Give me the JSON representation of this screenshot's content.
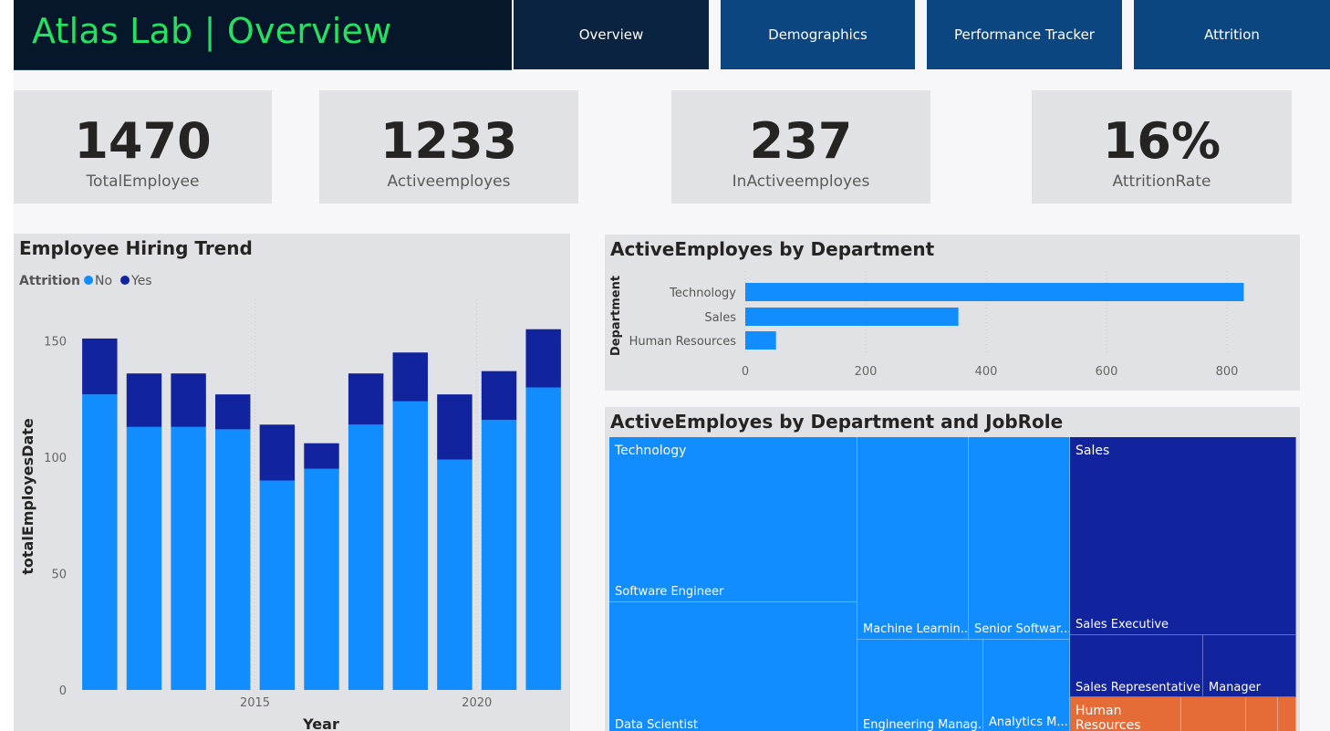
{
  "header": {
    "title": "Atlas Lab | Overview",
    "tabs": [
      {
        "label": "Overview",
        "active": true
      },
      {
        "label": "Demographics",
        "active": false
      },
      {
        "label": "Performance Tracker",
        "active": false
      },
      {
        "label": "Attrition",
        "active": false
      }
    ]
  },
  "kpis": [
    {
      "value": "1470",
      "label": "TotalEmployee"
    },
    {
      "value": "1233",
      "label": "Activeemployes"
    },
    {
      "value": "237",
      "label": "InActiveemployes"
    },
    {
      "value": "16%",
      "label": "AttritionRate"
    }
  ],
  "colors": {
    "no": "#118dff",
    "yes": "#12239e",
    "hr": "#e66c37",
    "title_green": "#26e062"
  },
  "hiring_chart": {
    "title": "Employee Hiring Trend",
    "legend_title": "Attrition",
    "chart_data": {
      "type": "bar",
      "stacked": true,
      "title": "Employee Hiring Trend",
      "xlabel": "Year",
      "ylabel": "totalEmployesDate",
      "categories": [
        2012,
        2013,
        2014,
        2015,
        2016,
        2017,
        2018,
        2019,
        2020,
        2021,
        2022
      ],
      "x_tick_labels": [
        "2015",
        "2020"
      ],
      "y_ticks": [
        0,
        50,
        100,
        150
      ],
      "ylim": [
        0,
        160
      ],
      "grid": true,
      "legend": "top-left",
      "series": [
        {
          "name": "No",
          "values": [
            127,
            113,
            113,
            112,
            90,
            95,
            114,
            124,
            99,
            116,
            130
          ]
        },
        {
          "name": "Yes",
          "values": [
            24,
            23,
            23,
            15,
            24,
            11,
            22,
            21,
            28,
            21,
            25
          ]
        }
      ]
    }
  },
  "dept_chart": {
    "title": "ActiveEmployes by Department",
    "chart_data": {
      "type": "bar",
      "orientation": "horizontal",
      "title": "ActiveEmployes by Department",
      "ylabel": "Department",
      "xlabel": "",
      "categories": [
        "Technology",
        "Sales",
        "Human Resources"
      ],
      "values": [
        828,
        354,
        51
      ],
      "x_ticks": [
        0,
        200,
        400,
        600,
        800
      ],
      "xlim": [
        0,
        870
      ],
      "grid": true
    }
  },
  "treemap": {
    "title": "ActiveEmployes by Department and JobRole",
    "departments": [
      "Technology",
      "Sales",
      "Human Resources"
    ],
    "roles": [
      "Software Engineer",
      "Data Scientist",
      "Machine Learnin...",
      "Senior Softwar...",
      "Engineering Manag...",
      "Analytics M...",
      "Sales Executive",
      "Sales Representative",
      "Manager"
    ]
  }
}
